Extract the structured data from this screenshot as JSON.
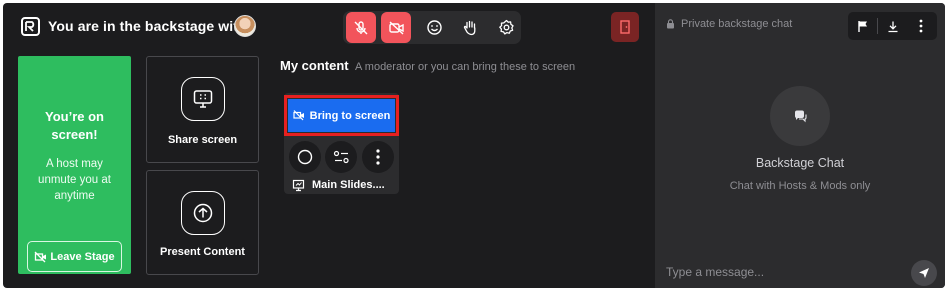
{
  "header": {
    "title": "You are in the backstage with"
  },
  "toolbar": {
    "buttons": [
      "mic-off",
      "camera-off",
      "reactions",
      "raise-hand",
      "settings"
    ]
  },
  "stage": {
    "onscreen_title": "You’re on screen!",
    "onscreen_subtitle": "A host may unmute you at anytime",
    "leave_label": "Leave Stage",
    "share_label": "Share screen",
    "present_label": "Present Content"
  },
  "content": {
    "title": "My content",
    "subtitle": "A moderator or you can bring these to screen",
    "bring_label": "Bring to screen",
    "item_name": "Main Slides...."
  },
  "chat": {
    "header": "Private backstage chat",
    "title": "Backstage Chat",
    "subtitle": "Chat with Hosts & Mods only",
    "placeholder": "Type a message..."
  },
  "colors": {
    "background": "#1c1c1e",
    "panel": "#2c2c2e",
    "green": "#2ebd5f",
    "blue": "#1a6cf0",
    "red": "#f2545b",
    "highlight": "#e62020"
  }
}
